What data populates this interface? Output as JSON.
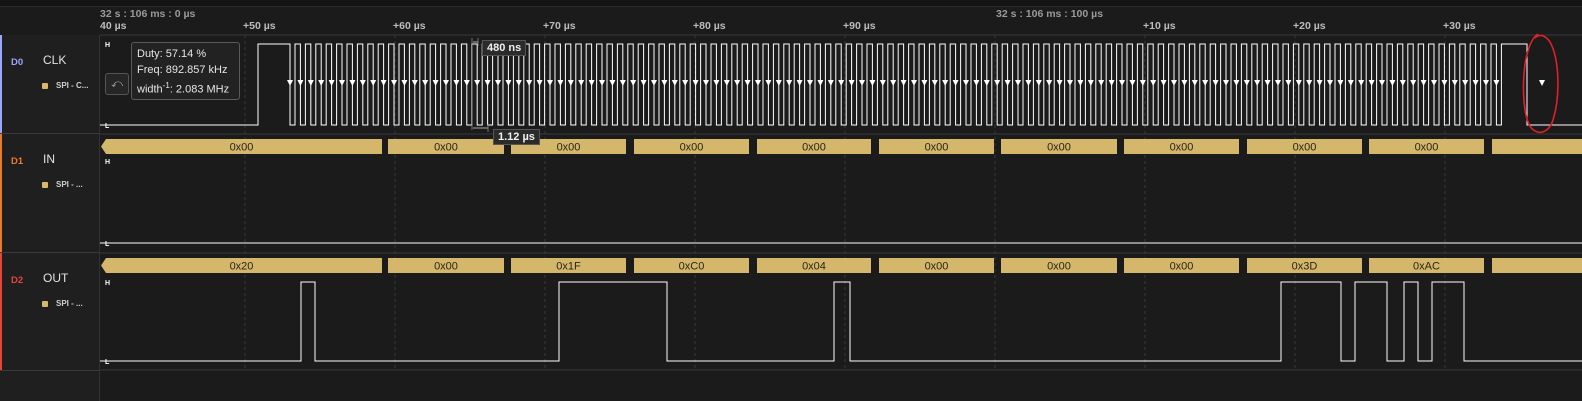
{
  "ruler": {
    "start_label": "40 µs",
    "origin_label": "32 s : 106 ms : 0 µs",
    "mid_label": "32 s : 106 ms : 100 µs",
    "ticks": [
      "+50 µs",
      "+60 µs",
      "+70 µs",
      "+80 µs",
      "+90 µs",
      "+10 µs",
      "+20 µs",
      "+30 µs"
    ]
  },
  "channels": [
    {
      "id": "D0",
      "name": "CLK",
      "protocol": "SPI - C...",
      "color": "#9aa7ff"
    },
    {
      "id": "D1",
      "name": "IN",
      "protocol": "SPI - ...",
      "color": "#e87c2a"
    },
    {
      "id": "D2",
      "name": "OUT",
      "protocol": "SPI - ...",
      "color": "#e8443a"
    }
  ],
  "level_labels": {
    "high": "H",
    "low": "L"
  },
  "tooltip": {
    "duty": "Duty: 57.14 %",
    "freq": "Freq: 892.857 kHz",
    "width_prefix": "width",
    "width_sup": "-1",
    "width_value": ": 2.083 MHz"
  },
  "measurements": {
    "pulse_width": "480 ns",
    "period": "1.12 µs"
  },
  "in_bytes": [
    "0x00",
    "0x00",
    "0x00",
    "0x00",
    "0x00",
    "0x00",
    "0x00",
    "0x00",
    "0x00",
    "0x00",
    ""
  ],
  "out_bytes": [
    "0x20",
    "0x00",
    "0x1F",
    "0xC0",
    "0x04",
    "0x00",
    "0x00",
    "0x00",
    "0x3D",
    "0xAC",
    ""
  ],
  "colors": {
    "decode": "#d4b76a",
    "wave": "#ffffff",
    "grid": "#3a3a3a",
    "annotation": "#e0202a"
  }
}
